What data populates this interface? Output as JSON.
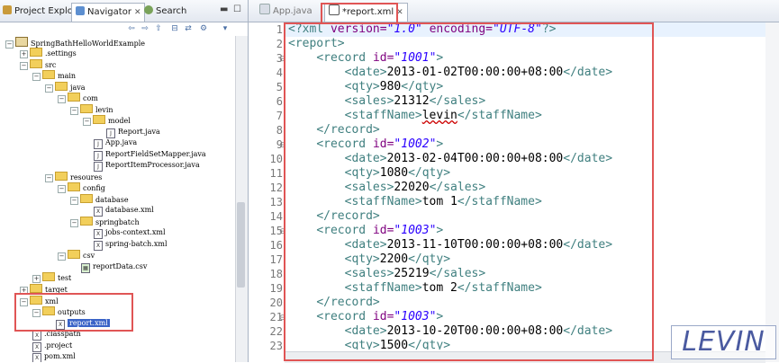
{
  "left_panel": {
    "tabs": [
      {
        "label": "Project Explorer",
        "icon": "project-explorer-icon"
      },
      {
        "label": "Navigator",
        "icon": "navigator-icon"
      },
      {
        "label": "Search",
        "icon": "search-icon"
      }
    ],
    "tree": [
      {
        "label": "SpringBathHelloWorldExample",
        "kind": "project"
      },
      {
        "label": ".settings",
        "kind": "folder"
      },
      {
        "label": "src",
        "kind": "folder"
      },
      {
        "label": "main",
        "kind": "folder"
      },
      {
        "label": "java",
        "kind": "folder"
      },
      {
        "label": "com",
        "kind": "folder"
      },
      {
        "label": "levin",
        "kind": "folder"
      },
      {
        "label": "model",
        "kind": "folder"
      },
      {
        "label": "Report.java",
        "kind": "java"
      },
      {
        "label": "App.java",
        "kind": "java"
      },
      {
        "label": "ReportFieldSetMapper.java",
        "kind": "java"
      },
      {
        "label": "ReportItemProcessor.java",
        "kind": "java"
      },
      {
        "label": "resoures",
        "kind": "folder"
      },
      {
        "label": "config",
        "kind": "folder"
      },
      {
        "label": "database",
        "kind": "folder"
      },
      {
        "label": "database.xml",
        "kind": "xml"
      },
      {
        "label": "springbatch",
        "kind": "folder"
      },
      {
        "label": "jobs-context.xml",
        "kind": "xml"
      },
      {
        "label": "spring-batch.xml",
        "kind": "xml"
      },
      {
        "label": "csv",
        "kind": "folder"
      },
      {
        "label": "reportData.csv",
        "kind": "csv"
      },
      {
        "label": "test",
        "kind": "folder"
      },
      {
        "label": "target",
        "kind": "folder"
      },
      {
        "label": "xml",
        "kind": "folder"
      },
      {
        "label": "outputs",
        "kind": "folder"
      },
      {
        "label": "report.xml",
        "kind": "xml"
      },
      {
        "label": ".classpath",
        "kind": "xml"
      },
      {
        "label": ".project",
        "kind": "xml"
      },
      {
        "label": "pom.xml",
        "kind": "xml"
      }
    ]
  },
  "editor": {
    "tabs": [
      {
        "label": "App.java",
        "icon": "java-file-icon"
      },
      {
        "label": "*report.xml",
        "icon": "xml-file-icon"
      }
    ],
    "line_numbers": [
      "1",
      "2",
      "3",
      "4",
      "5",
      "6",
      "7",
      "8",
      "9",
      "10",
      "11",
      "12",
      "13",
      "14",
      "15",
      "16",
      "17",
      "18",
      "19",
      "20",
      "21",
      "22",
      "23"
    ],
    "xml_decl": {
      "version": "1.0",
      "encoding": "UTF-8"
    },
    "records": [
      {
        "id": "1001",
        "date": "2013-01-02T00:00:00+08:00",
        "qty": "980",
        "sales": "21312",
        "staffName": "levin"
      },
      {
        "id": "1002",
        "date": "2013-02-04T00:00:00+08:00",
        "qty": "1080",
        "sales": "22020",
        "staffName": "tom 1"
      },
      {
        "id": "1003",
        "date": "2013-11-10T00:00:00+08:00",
        "qty": "2200",
        "sales": "25219",
        "staffName": "tom 2"
      },
      {
        "id": "1003",
        "date": "2013-10-20T00:00:00+08:00",
        "qty": "1500"
      }
    ]
  },
  "watermark": "LEVIN"
}
